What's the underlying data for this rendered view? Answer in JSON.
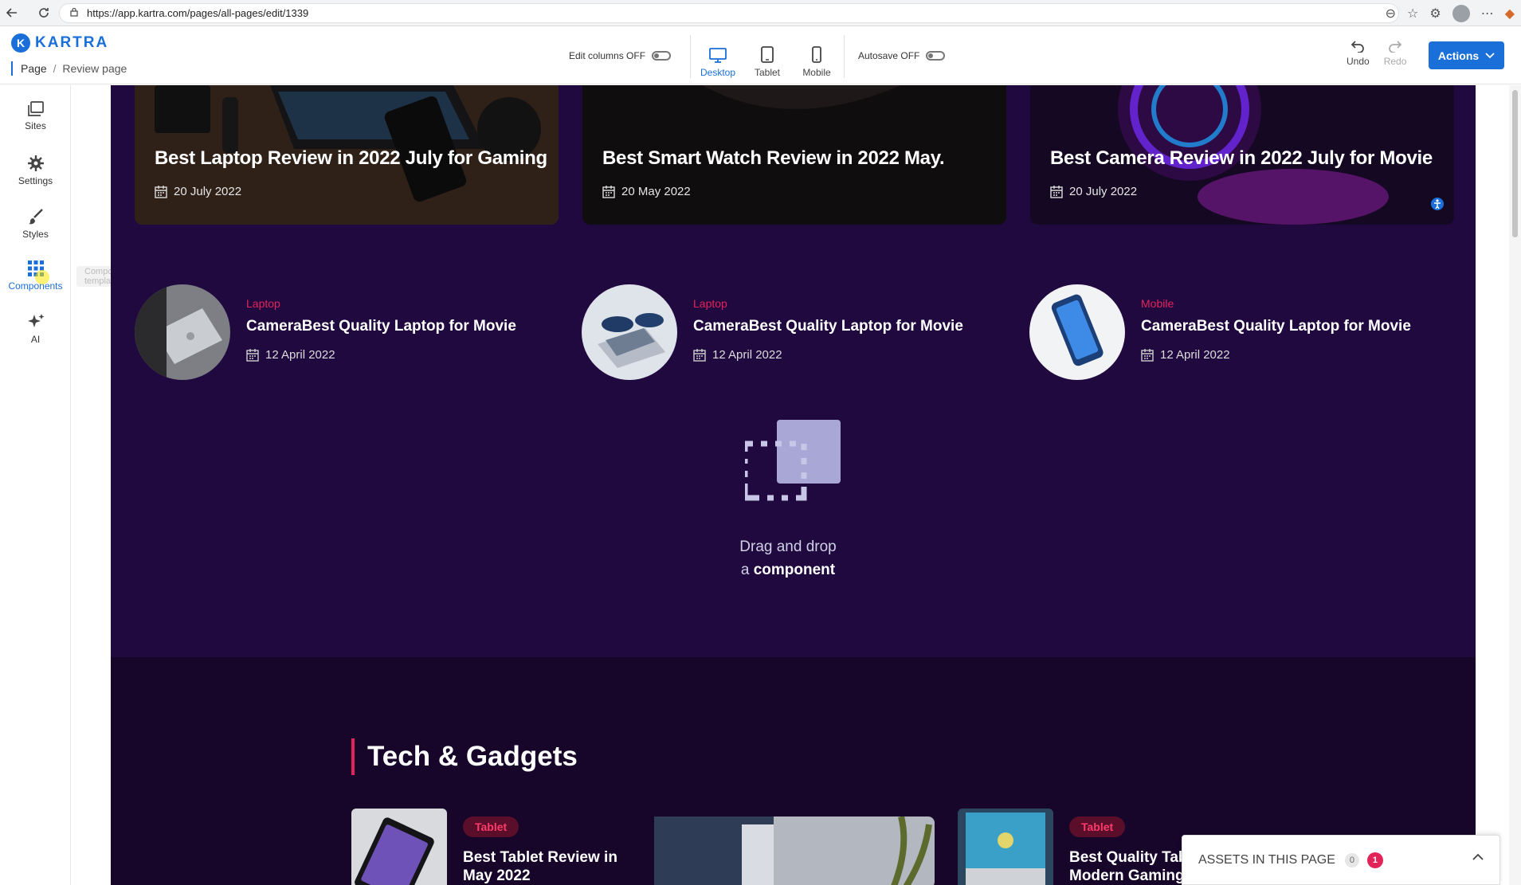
{
  "browser": {
    "url": "https://app.kartra.com/pages/all-pages/edit/1339"
  },
  "header": {
    "logo_text": "KARTRA",
    "logo_letter": "K",
    "breadcrumb_root": "Page",
    "breadcrumb_sep": "/",
    "breadcrumb_current": "Review page",
    "edit_columns_label": "Edit columns OFF",
    "autosave_label": "Autosave OFF",
    "devices": [
      {
        "label": "Desktop",
        "active": true
      },
      {
        "label": "Tablet",
        "active": false
      },
      {
        "label": "Mobile",
        "active": false
      }
    ],
    "undo_label": "Undo",
    "redo_label": "Redo",
    "actions_label": "Actions"
  },
  "sidebar": {
    "items": [
      {
        "label": "Sites",
        "icon": "sites-icon"
      },
      {
        "label": "Settings",
        "icon": "gear-icon"
      },
      {
        "label": "Styles",
        "icon": "brush-icon"
      },
      {
        "label": "Components",
        "icon": "grid-icon"
      },
      {
        "label": "AI",
        "icon": "sparkles-icon"
      }
    ],
    "tooltip": "Component templates"
  },
  "featured": [
    {
      "title": "Best Laptop Review in 2022 July for Gaming",
      "date": "20 July 2022"
    },
    {
      "title": "Best Smart Watch Review in 2022 May.",
      "date": "20 May 2022"
    },
    {
      "title": "Best Camera Review in 2022 July for Movie",
      "date": "20 July 2022"
    }
  ],
  "posts": [
    {
      "category": "Laptop",
      "title": "CameraBest Quality Laptop for Movie",
      "date": "12 April 2022"
    },
    {
      "category": "Laptop",
      "title": "CameraBest Quality Laptop for Movie",
      "date": "12 April 2022"
    },
    {
      "category": "Mobile",
      "title": "CameraBest Quality Laptop for Movie",
      "date": "12 April 2022"
    }
  ],
  "dropzone": {
    "line1": "Drag and drop",
    "line2_prefix": "a",
    "line2_bold": "component"
  },
  "tech_section": {
    "title": "Tech & Gadgets",
    "cards": [
      {
        "category": "Tablet",
        "title_line1": "Best Tablet Review in",
        "title_line2": "May 2022"
      },
      {
        "category": "Tablet",
        "title_line1": "Best Quality Tabl",
        "title_line2": "Modern Gaming"
      }
    ]
  },
  "assets": {
    "label": "ASSETS IN THIS PAGE",
    "count": "0",
    "alerts": "1"
  },
  "colors": {
    "accent": "#1a6fd8",
    "canvas_bg": "#20093f",
    "category_red": "#e2245a"
  }
}
